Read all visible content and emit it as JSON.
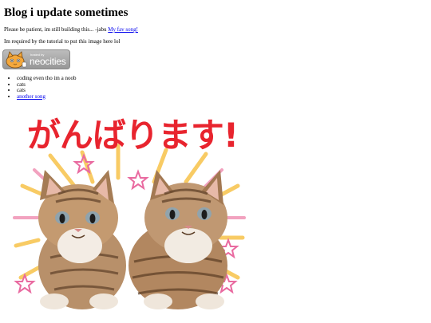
{
  "heading": "Blog i update sometimes",
  "intro": {
    "text": "Please be patient, im still building this... -jabu ",
    "link_label": "My fav song!"
  },
  "note": "Im required by the tutorial to put this image here lol",
  "badge": {
    "line1": "hosted by",
    "line2": "neocities"
  },
  "list_items": [
    {
      "label": "coding even tho im a noob",
      "is_link": false
    },
    {
      "label": "cats",
      "is_link": false
    },
    {
      "label": "cats",
      "is_link": false
    },
    {
      "label": "another song",
      "is_link": true
    }
  ],
  "image": {
    "caption_text": "がんばります!",
    "title_color": "#e8242e"
  }
}
